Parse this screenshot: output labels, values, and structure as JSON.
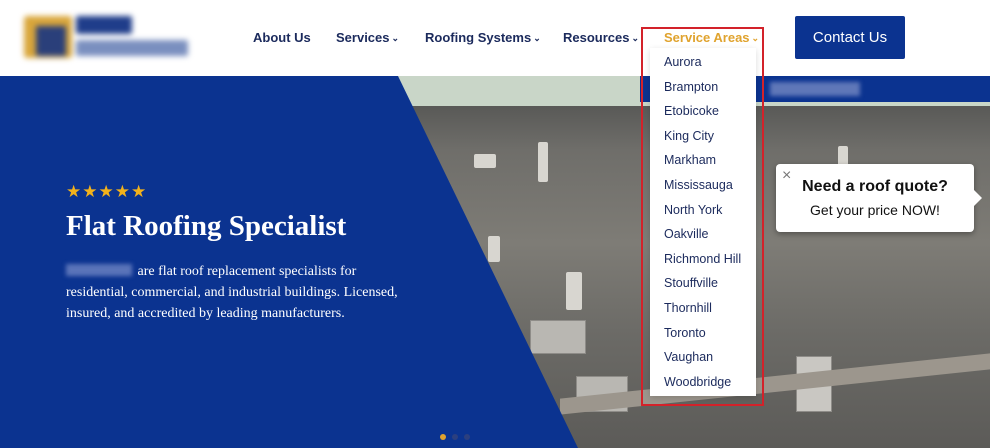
{
  "nav": {
    "items": [
      {
        "label": "About Us",
        "chevron": false
      },
      {
        "label": "Services",
        "chevron": true
      },
      {
        "label": "Roofing Systems",
        "chevron": true
      },
      {
        "label": "Resources",
        "chevron": true
      },
      {
        "label": "Service Areas",
        "chevron": true
      }
    ],
    "chevron_glyph": "⌄",
    "contact_label": "Contact Us"
  },
  "dropdown": {
    "items": [
      "Aurora",
      "Brampton",
      "Etobicoke",
      "King City",
      "Markham",
      "Mississauga",
      "North York",
      "Oakville",
      "Richmond Hill",
      "Stouffville",
      "Thornhill",
      "Toronto",
      "Vaughan",
      "Woodbridge"
    ]
  },
  "hero": {
    "stars": "★★★★★",
    "title": "Flat Roofing Specialist",
    "description": "are flat roof replacement specialists for residential, commercial, and industrial buildings. Licensed, insured, and accredited by leading manufacturers."
  },
  "quote": {
    "close": "×",
    "title": "Need a roof quote?",
    "subtitle": "Get your price NOW!"
  },
  "colors": {
    "brand_blue": "#0b3390",
    "accent_gold": "#e0a32e",
    "highlight_red": "#d3222a"
  }
}
